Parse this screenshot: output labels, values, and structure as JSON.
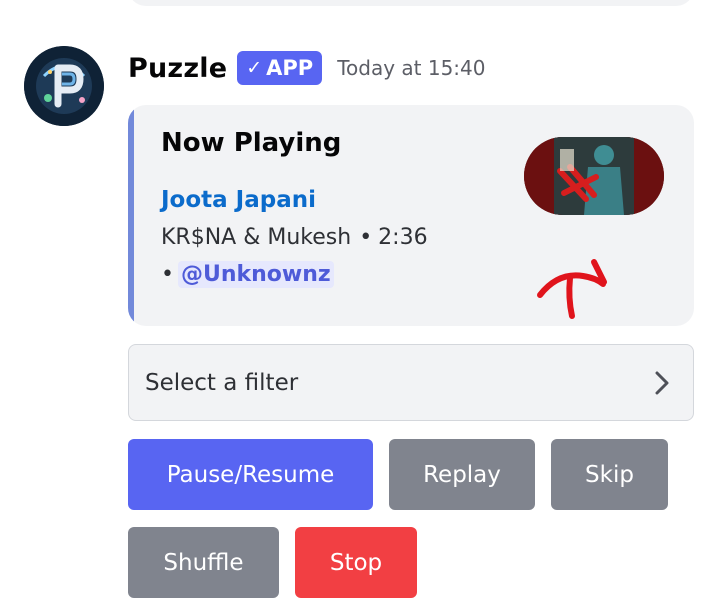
{
  "message": {
    "author": "Puzzle",
    "badge": "APP",
    "timestamp": "Today at 15:40"
  },
  "embed": {
    "title": "Now Playing",
    "track": "Joota Japani",
    "artists": "KR$NA & Mukesh",
    "duration": "2:36",
    "requester": "@Unknownz",
    "accent_color": "#7289da"
  },
  "filter_select": {
    "placeholder": "Select a filter"
  },
  "buttons": {
    "pause_resume": "Pause/Resume",
    "replay": "Replay",
    "skip": "Skip",
    "shuffle": "Shuffle",
    "stop": "Stop"
  },
  "colors": {
    "primary": "#5865f2",
    "secondary": "#80848e",
    "danger": "#f23f43",
    "annotation": "#e0141c"
  }
}
